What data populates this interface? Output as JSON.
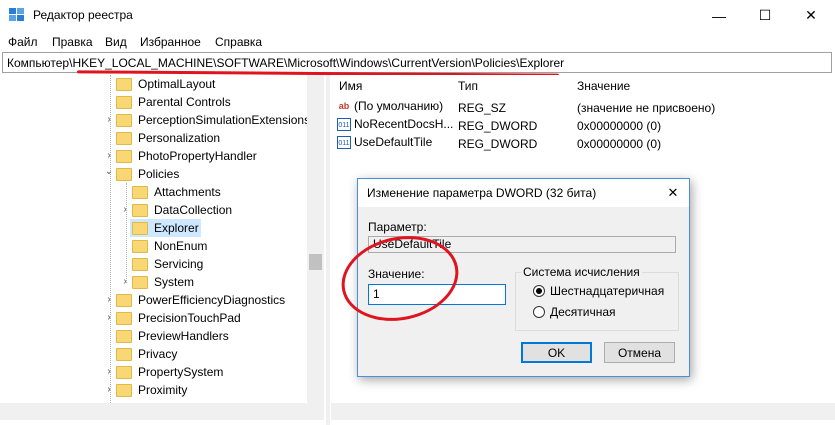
{
  "window": {
    "title": "Редактор реестра",
    "minimize_glyph": "—",
    "maximize_glyph": "☐",
    "close_glyph": "✕",
    "icon": "registry-editor-icon"
  },
  "menu": [
    "Файл",
    "Правка",
    "Вид",
    "Избранное",
    "Справка"
  ],
  "address": "Компьютер\\HKEY_LOCAL_MACHINE\\SOFTWARE\\Microsoft\\Windows\\CurrentVersion\\Policies\\Explorer",
  "tree": {
    "items": [
      {
        "label": "OptimalLayout",
        "expander": ""
      },
      {
        "label": "Parental Controls",
        "expander": ""
      },
      {
        "label": "PerceptionSimulationExtensions",
        "expander": "›"
      },
      {
        "label": "Personalization",
        "expander": ""
      },
      {
        "label": "PhotoPropertyHandler",
        "expander": "›"
      },
      {
        "label": "Policies",
        "expander": "⌄"
      },
      {
        "label": "Attachments",
        "expander": ""
      },
      {
        "label": "DataCollection",
        "expander": "›"
      },
      {
        "label": "Explorer",
        "expander": ""
      },
      {
        "label": "NonEnum",
        "expander": ""
      },
      {
        "label": "Servicing",
        "expander": ""
      },
      {
        "label": "System",
        "expander": "›"
      },
      {
        "label": "PowerEfficiencyDiagnostics",
        "expander": "›"
      },
      {
        "label": "PrecisionTouchPad",
        "expander": "›"
      },
      {
        "label": "PreviewHandlers",
        "expander": ""
      },
      {
        "label": "Privacy",
        "expander": ""
      },
      {
        "label": "PropertySystem",
        "expander": "›"
      },
      {
        "label": "Proximity",
        "expander": "›"
      }
    ]
  },
  "list": {
    "headers": {
      "name": "Имя",
      "type": "Тип",
      "value": "Значение"
    },
    "rows": [
      {
        "icon": "ab",
        "name": "(По умолчанию)",
        "type": "REG_SZ",
        "value": "(значение не присвоено)"
      },
      {
        "icon": "011",
        "name": "NoRecentDocsH...",
        "type": "REG_DWORD",
        "value": "0x00000000 (0)"
      },
      {
        "icon": "011",
        "name": "UseDefaultTile",
        "type": "REG_DWORD",
        "value": "0x00000000 (0)"
      }
    ]
  },
  "dialog": {
    "title": "Изменение параметра DWORD (32 бита)",
    "param_label": "Параметр:",
    "param_value": "UseDefaultTile",
    "value_label": "Значение:",
    "value": "1",
    "base_legend": "Система исчисления",
    "hex_label": "Шестнадцатеричная",
    "dec_label": "Десятичная",
    "ok": "OK",
    "cancel": "Отмена",
    "close_glyph": "✕"
  },
  "colors": {
    "annotation_red": "#e0141e",
    "selection": "#cde8ff",
    "accent": "#0078d7"
  }
}
